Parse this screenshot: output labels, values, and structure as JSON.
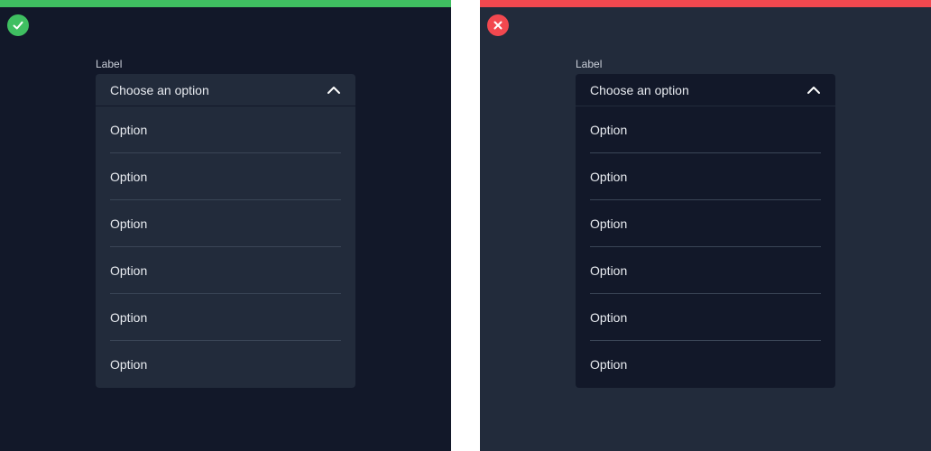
{
  "colors": {
    "good_bar": "#3fbf61",
    "bad_bar": "#f2484f",
    "good_bg": "#121829",
    "bad_bg": "#222b3b"
  },
  "panels": [
    {
      "variant": "do",
      "badge_icon": "check-icon",
      "label": "Label",
      "select_value": "Choose an option",
      "chevron_icon": "chevron-up-icon",
      "options": [
        "Option",
        "Option",
        "Option",
        "Option",
        "Option",
        "Option"
      ]
    },
    {
      "variant": "dont",
      "badge_icon": "close-icon",
      "label": "Label",
      "select_value": "Choose an option",
      "chevron_icon": "chevron-up-icon",
      "options": [
        "Option",
        "Option",
        "Option",
        "Option",
        "Option",
        "Option"
      ]
    }
  ]
}
